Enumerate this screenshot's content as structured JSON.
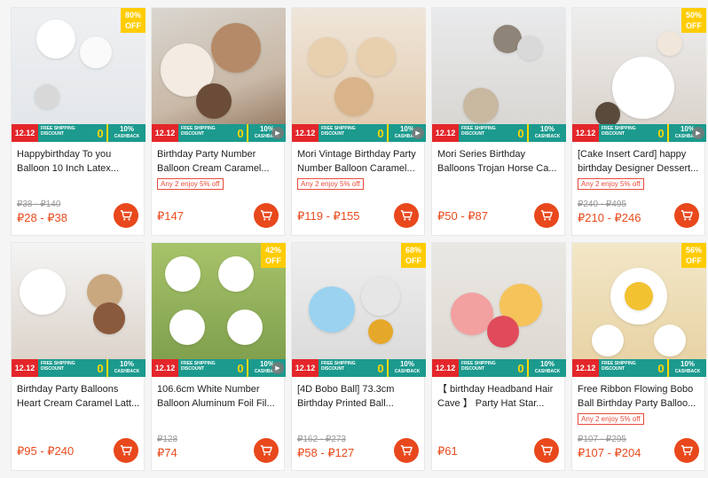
{
  "promo": {
    "event": "12.12",
    "ship_line1": "FREE SHIPPING",
    "ship_line2": "DISCOUNT",
    "zero": "0",
    "cash_pct": "10%",
    "cash_label": "CASHBACK"
  },
  "products": [
    {
      "title1": "Happybirthday To you",
      "title2": "Balloon 10 Inch Latex...",
      "tag": "",
      "old": "₽38 - ₽140",
      "price": "₽28 - ₽38",
      "discount": "80% OFF",
      "video": false
    },
    {
      "title1": "Birthday Party Number",
      "title2": "Balloon Cream Caramel...",
      "tag": "Any 2 enjoy 5% off",
      "old": "",
      "price": "₽147",
      "discount": "",
      "video": true
    },
    {
      "title1": "Mori Vintage Birthday Party",
      "title2": "Number Balloon Caramel...",
      "tag": "Any 2 enjoy 5% off",
      "old": "",
      "price": "₽119 - ₽155",
      "discount": "",
      "video": true
    },
    {
      "title1": "Mori Series Birthday",
      "title2": "Balloons Trojan Horse Ca...",
      "tag": "",
      "old": "",
      "price": "₽50 - ₽87",
      "discount": "",
      "video": false
    },
    {
      "title1": "[Cake Insert Card] happy",
      "title2": "birthday Designer Dessert...",
      "tag": "Any 2 enjoy 5% off",
      "old": "₽240 - ₽495",
      "price": "₽210 - ₽246",
      "discount": "50% OFF",
      "video": true
    },
    {
      "title1": "Birthday Party Balloons",
      "title2": "Heart Cream Caramel Latt...",
      "tag": "",
      "old": "",
      "price": "₽95 - ₽240",
      "discount": "",
      "video": false
    },
    {
      "title1": "106.6cm White Number",
      "title2": "Balloon Aluminum Foil Fil...",
      "tag": "",
      "old": "₽128",
      "price": "₽74",
      "discount": "42% OFF",
      "video": true
    },
    {
      "title1": "[4D Bobo Ball] 73.3cm",
      "title2": "Birthday Printed Ball...",
      "tag": "",
      "old": "₽162 - ₽273",
      "price": "₽58 - ₽127",
      "discount": "68% OFF",
      "video": false
    },
    {
      "title1": "【 birthday Headband Hair",
      "title2": "Cave 】 Party Hat Star...",
      "tag": "",
      "old": "",
      "price": "₽61",
      "discount": "",
      "video": false
    },
    {
      "title1": "Free Ribbon Flowing Bobo",
      "title2": "Ball Birthday Party Balloo...",
      "tag": "Any 2 enjoy 5% off",
      "old": "₽107 - ₽295",
      "price": "₽107 - ₽204",
      "discount": "56% OFF",
      "video": false
    }
  ],
  "colors": {
    "accent": "#e8481c",
    "badge": "#ffcc00",
    "promo_teal": "#1c9a8e",
    "promo_red": "#e3262a"
  },
  "icons": {
    "cart": "shopping-cart-icon",
    "play": "play-icon"
  }
}
